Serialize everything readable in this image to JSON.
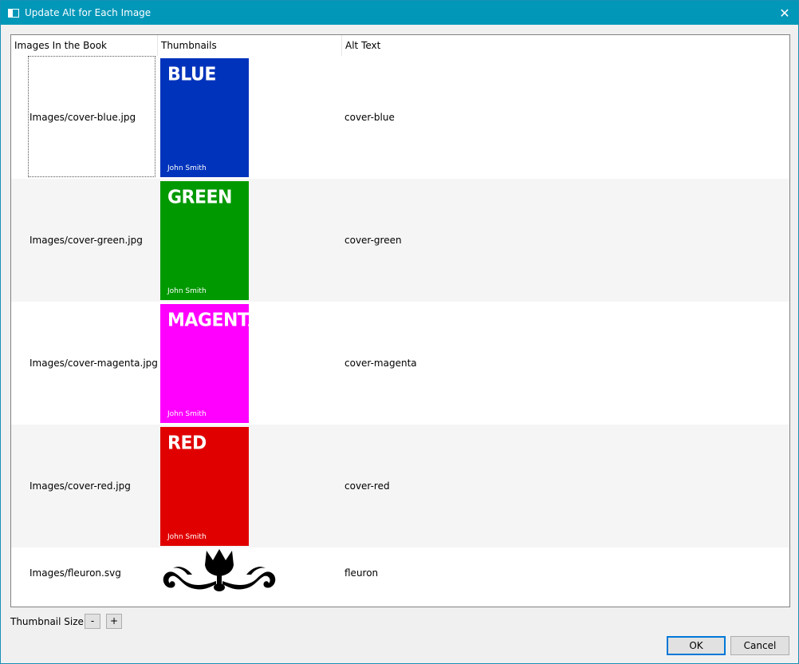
{
  "window": {
    "title": "Update Alt for Each Image",
    "close_glyph": "✕"
  },
  "table": {
    "columns": [
      "Images In the Book",
      "Thumbnails",
      "Alt Text"
    ],
    "rows": [
      {
        "path": "Images/cover-blue.jpg",
        "alt": "cover-blue",
        "thumb": {
          "label": "BLUE",
          "author": "John Smith",
          "color": "#0033bb"
        }
      },
      {
        "path": "Images/cover-green.jpg",
        "alt": "cover-green",
        "thumb": {
          "label": "GREEN",
          "author": "John Smith",
          "color": "#009900"
        }
      },
      {
        "path": "Images/cover-magenta.jpg",
        "alt": "cover-magenta",
        "thumb": {
          "label": "MAGENTA",
          "author": "John Smith",
          "color": "#ff00ff"
        }
      },
      {
        "path": "Images/cover-red.jpg",
        "alt": "cover-red",
        "thumb": {
          "label": "RED",
          "author": "John Smith",
          "color": "#e00000"
        }
      },
      {
        "path": "Images/fleuron.svg",
        "alt": "fleuron",
        "thumb": {
          "icon": "fleuron-ornament-icon"
        }
      }
    ]
  },
  "footer": {
    "thumbnail_size_label": "Thumbnail Size",
    "decrease_label": "-",
    "increase_label": "+",
    "ok_label": "OK",
    "cancel_label": "Cancel"
  },
  "colors": {
    "titlebar": "#0097b9",
    "focus": "#0078d7"
  }
}
